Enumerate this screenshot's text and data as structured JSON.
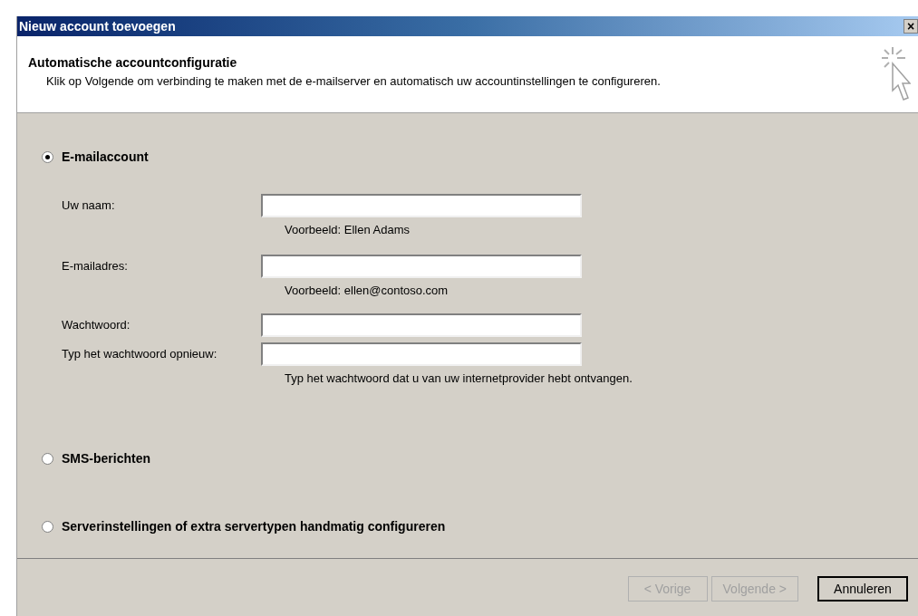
{
  "window": {
    "title": "Nieuw account toevoegen",
    "close": "×"
  },
  "header": {
    "title": "Automatische accountconfiguratie",
    "description": "Klik op Volgende om verbinding te maken met de e-mailserver en automatisch uw accountinstellingen te configureren."
  },
  "options": [
    {
      "label": "E-mailaccount",
      "selected": true,
      "fields": [
        {
          "label": "Uw naam:",
          "hint": "Voorbeeld: Ellen Adams"
        },
        {
          "label": "E-mailadres:",
          "hint": "Voorbeeld: ellen@contoso.com"
        },
        {
          "label": "Wachtwoord:"
        },
        {
          "label": "Typ het wachtwoord opnieuw:",
          "hint": "Typ het wachtwoord dat u van uw internetprovider hebt ontvangen."
        }
      ]
    },
    {
      "label": "SMS-berichten",
      "selected": false
    },
    {
      "label": "Serverinstellingen of extra servertypen handmatig configureren",
      "selected": false
    }
  ],
  "buttons": [
    {
      "label": "< Vorige",
      "disabled": true,
      "default": false
    },
    {
      "label": "Volgende >",
      "disabled": true,
      "default": false
    },
    {
      "label": "Annuleren",
      "disabled": false,
      "default": true
    }
  ]
}
